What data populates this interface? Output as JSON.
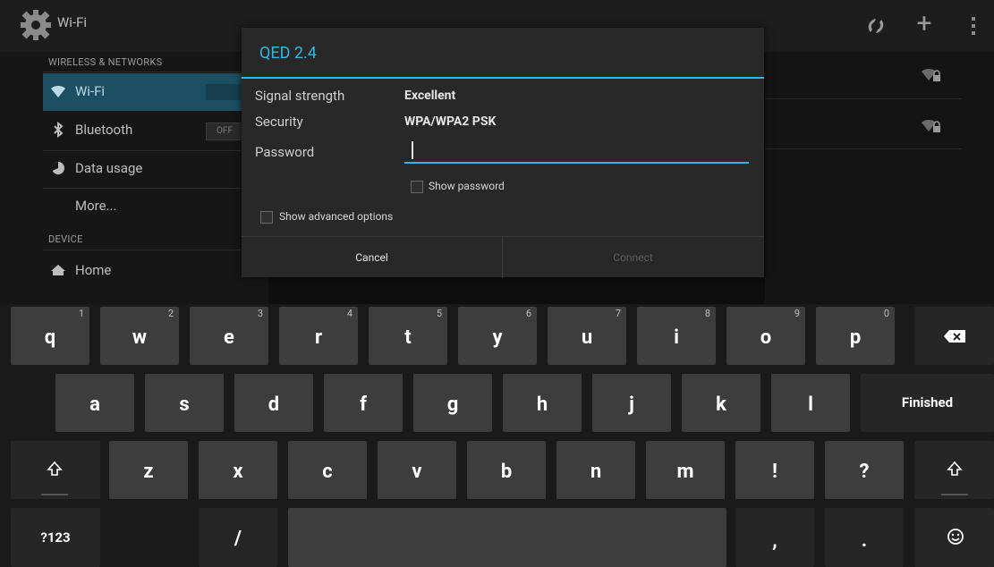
{
  "actionbar": {
    "title": "Wi-Fi"
  },
  "settings": {
    "section_wireless": "WIRELESS & NETWORKS",
    "section_device": "DEVICE",
    "items": [
      {
        "label": "Wi-Fi"
      },
      {
        "label": "Bluetooth",
        "toggle": "OFF"
      },
      {
        "label": "Data usage"
      },
      {
        "label": "More..."
      },
      {
        "label": "Home"
      }
    ]
  },
  "dialog": {
    "title": "QED 2.4",
    "signal_label": "Signal strength",
    "signal_value": "Excellent",
    "security_label": "Security",
    "security_value": "WPA/WPA2 PSK",
    "password_label": "Password",
    "password_value": "",
    "show_password": "Show password",
    "show_advanced": "Show advanced options",
    "cancel": "Cancel",
    "connect": "Connect"
  },
  "keyboard": {
    "row1": [
      {
        "k": "q",
        "n": "1"
      },
      {
        "k": "w",
        "n": "2"
      },
      {
        "k": "e",
        "n": "3"
      },
      {
        "k": "r",
        "n": "4"
      },
      {
        "k": "t",
        "n": "5"
      },
      {
        "k": "y",
        "n": "6"
      },
      {
        "k": "u",
        "n": "7"
      },
      {
        "k": "i",
        "n": "8"
      },
      {
        "k": "o",
        "n": "9"
      },
      {
        "k": "p",
        "n": "0"
      }
    ],
    "row2": [
      "a",
      "s",
      "d",
      "f",
      "g",
      "h",
      "j",
      "k",
      "l"
    ],
    "finished": "Finished",
    "row3": [
      "z",
      "x",
      "c",
      "v",
      "b",
      "n",
      "m",
      "!",
      "?"
    ],
    "symbols": "?123",
    "slash": "/",
    "comma": ",",
    "period": "."
  },
  "colors": {
    "accent": "#33b5e5",
    "selected_row": "#1d4f63"
  }
}
